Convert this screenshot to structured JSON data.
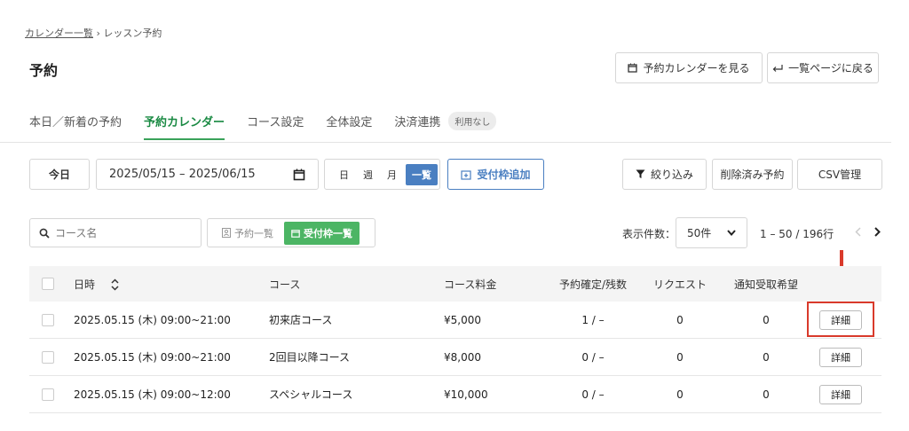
{
  "breadcrumb": {
    "parent": "カレンダー一覧",
    "separator": "›",
    "current": "レッスン予約"
  },
  "page_title": "予約",
  "header_buttons": {
    "view_calendar": "予約カレンダーを見る",
    "back_to_list": "一覧ページに戻る"
  },
  "tabs": [
    {
      "label": "本日／新着の予約"
    },
    {
      "label": "予約カレンダー"
    },
    {
      "label": "コース設定"
    },
    {
      "label": "全体設定"
    },
    {
      "label": "決済連携"
    }
  ],
  "payment_badge": "利用なし",
  "toolbar": {
    "today": "今日",
    "date_range": "2025/05/15 – 2025/06/15",
    "view_day": "日",
    "view_week": "週",
    "view_month": "月",
    "view_list": "一覧",
    "add_slot": "受付枠追加",
    "filter": "絞り込み",
    "deleted": "削除済み予約",
    "csv": "CSV管理"
  },
  "search": {
    "placeholder": "コース名"
  },
  "list_toggle": {
    "reservations": "予約一覧",
    "slots": "受付枠一覧"
  },
  "pagination": {
    "per_page_label": "表示件数：",
    "per_page": "50件",
    "range": "1 – 50 / 196行"
  },
  "table": {
    "headers": {
      "datetime": "日時",
      "course": "コース",
      "fee": "コース料金",
      "confirmed": "予約確定/残数",
      "request": "リクエスト",
      "notify": "通知受取希望"
    },
    "rows": [
      {
        "datetime": "2025.05.15 (木) 09:00~21:00",
        "course": "初来店コース",
        "fee": "¥5,000",
        "confirmed": "1 / –",
        "request": "0",
        "notify": "0",
        "action": "詳細"
      },
      {
        "datetime": "2025.05.15 (木) 09:00~21:00",
        "course": "2回目以降コース",
        "fee": "¥8,000",
        "confirmed": "0 / –",
        "request": "0",
        "notify": "0",
        "action": "詳細"
      },
      {
        "datetime": "2025.05.15 (木) 09:00~12:00",
        "course": "スペシャルコース",
        "fee": "¥10,000",
        "confirmed": "0 / –",
        "request": "0",
        "notify": "0",
        "action": "詳細"
      }
    ]
  },
  "colors": {
    "accent_green": "#3aa25a",
    "accent_blue": "#4a7fc1",
    "highlight_red": "#d93a2b"
  }
}
